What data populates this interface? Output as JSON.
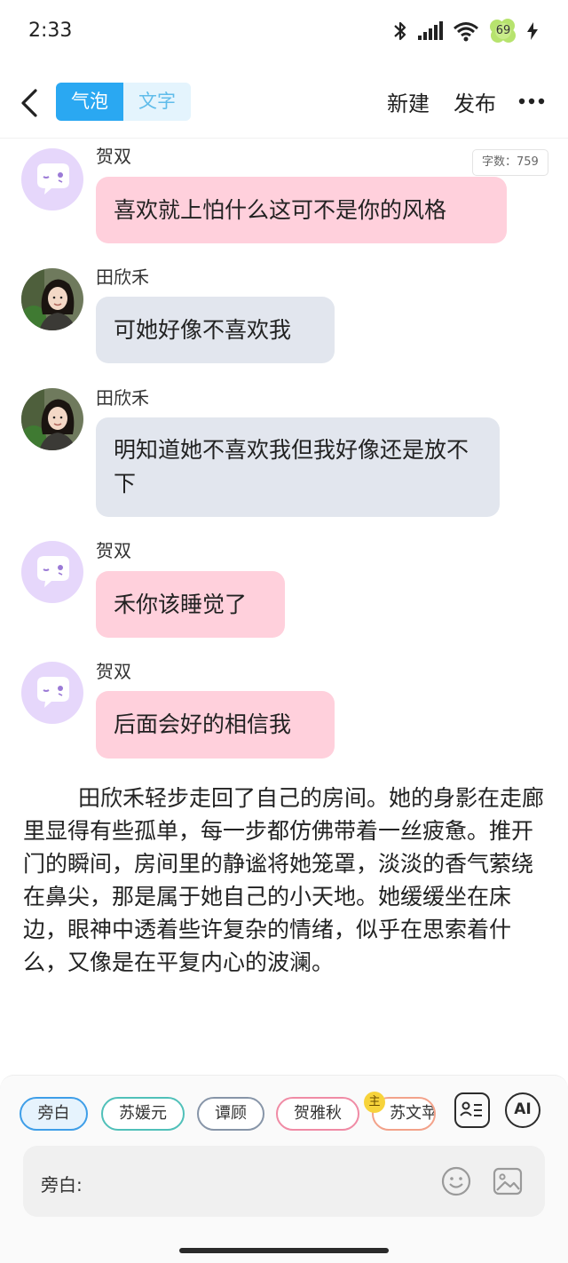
{
  "status_bar": {
    "time": "2:33",
    "battery_level": "69",
    "icons": [
      "bluetooth-icon",
      "signal-icon",
      "wifi-icon",
      "battery-icon",
      "charging-icon"
    ]
  },
  "header": {
    "tabs": [
      {
        "label": "气泡",
        "active": true
      },
      {
        "label": "文字",
        "active": false
      }
    ],
    "new_label": "新建",
    "publish_label": "发布",
    "accent_color": "#2aa8f2"
  },
  "word_count": "字数：759",
  "messages": [
    {
      "sender": "贺双",
      "text": "喜欢就上怕什么这可不是你的风格",
      "style": "pink"
    },
    {
      "sender": "田欣禾",
      "text": "可她好像不喜欢我",
      "style": "gray"
    },
    {
      "sender": "田欣禾",
      "text": "明知道她不喜欢我但我好像还是放不下",
      "style": "gray"
    },
    {
      "sender": "贺双",
      "text": "禾你该睡觉了",
      "style": "pink"
    },
    {
      "sender": "贺双",
      "text": "后面会好的相信我",
      "style": "pink"
    }
  ],
  "narration": "田欣禾轻步走回了自己的房间。她的身影在走廊里显得有些孤单，每一步都仿佛带着一丝疲惫。推开门的瞬间，房间里的静谧将她笼罩，淡淡的香气萦绕在鼻尖，那是属于她自己的小天地。她缓缓坐在床边，眼神中透着些许复杂的情绪，似乎在思索着什么，又像是在平复内心的波澜。",
  "characters": [
    {
      "name": "旁白",
      "selected": true
    },
    {
      "name": "苏媛元",
      "selected": false
    },
    {
      "name": "谭顾",
      "selected": false
    },
    {
      "name": "贺雅秋",
      "selected": false
    },
    {
      "name": "苏文苹",
      "selected": false,
      "badge": "主"
    }
  ],
  "ai_label": "AI",
  "input": {
    "label": "旁白:"
  }
}
